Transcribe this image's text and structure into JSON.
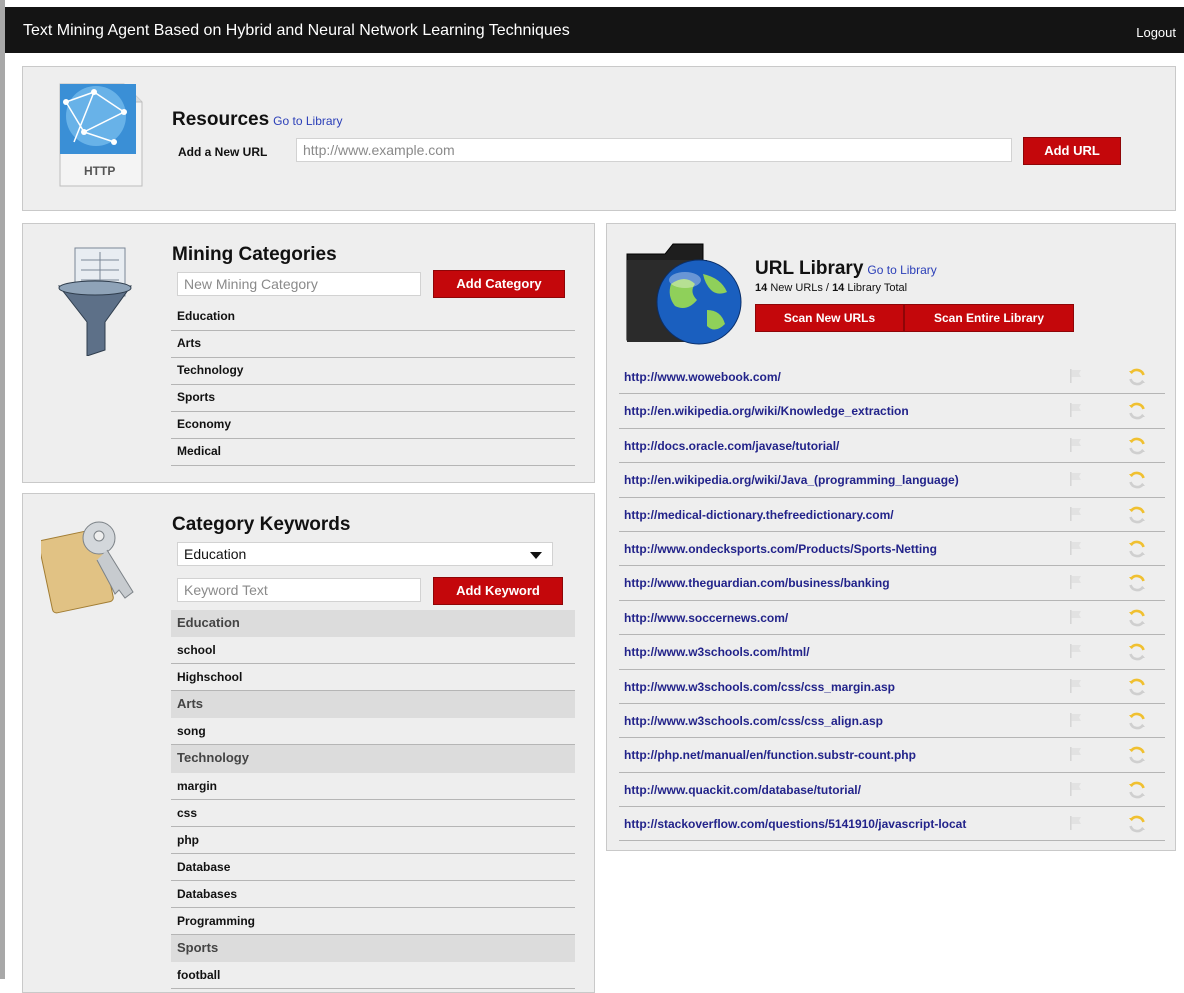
{
  "header": {
    "title": "Text Mining Agent Based on Hybrid and Neural Network Learning Techniques",
    "logout": "Logout"
  },
  "resources": {
    "title": "Resources",
    "go_to_library": "Go to Library",
    "http_label": "HTTP",
    "add_url_label": "Add a New URL",
    "url_placeholder": "http://www.example.com",
    "add_url_button": "Add URL"
  },
  "mining": {
    "title": "Mining Categories",
    "placeholder": "New Mining Category",
    "add_button": "Add Category",
    "categories": [
      "Education",
      "Arts",
      "Technology",
      "Sports",
      "Economy",
      "Medical"
    ]
  },
  "keywords": {
    "title": "Category Keywords",
    "selected_category": "Education",
    "placeholder": "Keyword Text",
    "add_button": "Add Keyword",
    "rows": [
      {
        "text": "Education",
        "header": true
      },
      {
        "text": "school",
        "header": false
      },
      {
        "text": "Highschool",
        "header": false
      },
      {
        "text": "Arts",
        "header": true
      },
      {
        "text": "song",
        "header": false
      },
      {
        "text": "Technology",
        "header": true
      },
      {
        "text": "margin",
        "header": false
      },
      {
        "text": "css",
        "header": false
      },
      {
        "text": "php",
        "header": false
      },
      {
        "text": "Database",
        "header": false
      },
      {
        "text": "Databases",
        "header": false
      },
      {
        "text": "Programming",
        "header": false
      },
      {
        "text": "Sports",
        "header": true
      },
      {
        "text": "football",
        "header": false
      }
    ]
  },
  "library": {
    "title": "URL Library",
    "go_to_library": "Go to Library",
    "new_count": "14",
    "new_label": "New URLs /",
    "total_count": "14",
    "total_label": "Library Total",
    "scan_new": "Scan New URLs",
    "scan_all": "Scan Entire Library",
    "urls": [
      "http://www.wowebook.com/",
      "http://en.wikipedia.org/wiki/Knowledge_extraction",
      "http://docs.oracle.com/javase/tutorial/",
      "http://en.wikipedia.org/wiki/Java_(programming_language)",
      "http://medical-dictionary.thefreedictionary.com/",
      "http://www.ondecksports.com/Products/Sports-Netting",
      "http://www.theguardian.com/business/banking",
      "http://www.soccernews.com/",
      "http://www.w3schools.com/html/",
      "http://www.w3schools.com/css/css_margin.asp",
      "http://www.w3schools.com/css/css_align.asp",
      "http://php.net/manual/en/function.substr-count.php",
      "http://www.quackit.com/database/tutorial/",
      "http://stackoverflow.com/questions/5141910/javascript-locat"
    ]
  },
  "colors": {
    "accent": "#c4070b",
    "link": "#22238a",
    "header_bg": "#141414",
    "panel_bg": "#eeeeee"
  }
}
